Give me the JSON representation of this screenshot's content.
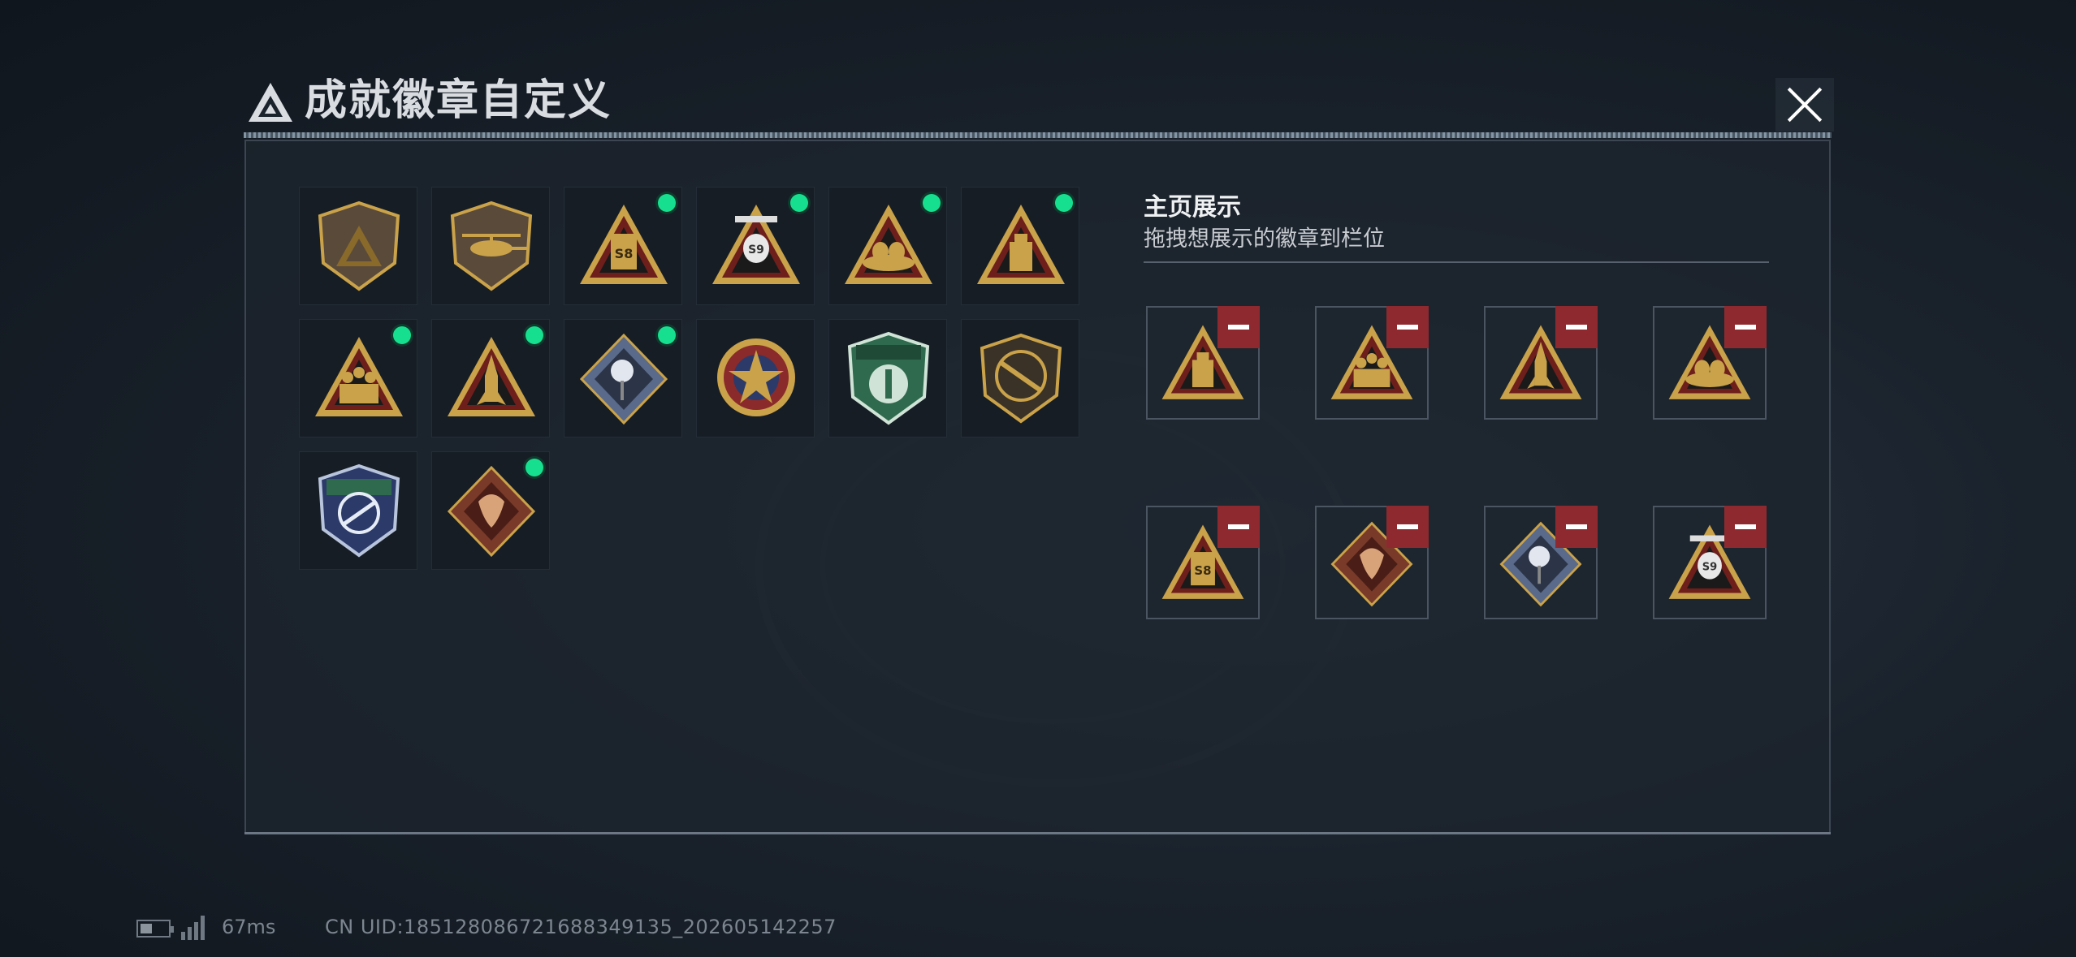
{
  "header": {
    "title": "成就徽章自定义",
    "close_icon": "close-icon"
  },
  "badges": [
    {
      "icon": "shield-triangle-badge",
      "new": false
    },
    {
      "icon": "helicopter-shield-badge",
      "new": false
    },
    {
      "icon": "s8-gold-triangle-badge",
      "new": true
    },
    {
      "icon": "s9-parachute-triangle-badge",
      "new": true
    },
    {
      "icon": "nest-eggs-triangle-badge",
      "new": true
    },
    {
      "icon": "usb-drive-triangle-badge",
      "new": true
    },
    {
      "icon": "soldiers-triangle-badge",
      "new": true
    },
    {
      "icon": "rocket-triangle-badge",
      "new": true
    },
    {
      "icon": "rose-diamond-badge",
      "new": true
    },
    {
      "icon": "star-medallion-badge",
      "new": false
    },
    {
      "icon": "green-shield-badge",
      "new": false
    },
    {
      "icon": "rifle-shield-badge",
      "new": false
    },
    {
      "icon": "crosshair-knife-shield-badge",
      "new": false
    },
    {
      "icon": "dragon-diamond-badge",
      "new": true
    }
  ],
  "showcase": {
    "title": "主页展示",
    "subtitle": "拖拽想展示的徽章到栏位",
    "slots": [
      {
        "icon": "usb-drive-triangle-badge"
      },
      {
        "icon": "soldiers-triangle-badge"
      },
      {
        "icon": "rocket-triangle-badge"
      },
      {
        "icon": "nest-eggs-triangle-badge"
      },
      {
        "icon": "s8-gold-triangle-badge"
      },
      {
        "icon": "dragon-diamond-badge"
      },
      {
        "icon": "rose-diamond-badge"
      },
      {
        "icon": "s9-parachute-triangle-badge"
      }
    ],
    "remove_icon": "minus-icon"
  },
  "status_bar": {
    "ping": "67ms",
    "uid": "CN UID:185128086721688349135_202605142257"
  },
  "colors": {
    "new_dot": "#16e08f",
    "remove_button": "#8e2a2f",
    "gold": "#c9a24a",
    "dark_red": "#6e1f1c"
  }
}
